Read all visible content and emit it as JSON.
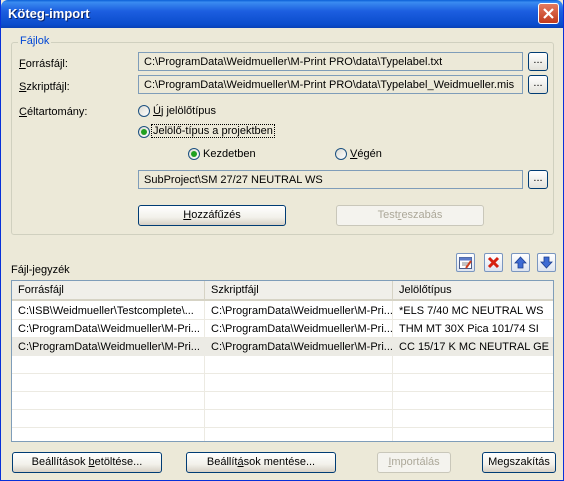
{
  "window": {
    "title": "Köteg-import"
  },
  "group": {
    "label": "Fájlok"
  },
  "files": {
    "source_label_pre": "",
    "source_label_ul": "F",
    "source_label_post": "orrásfájl:",
    "source_path": "C:\\ProgramData\\Weidmueller\\M-Print PRO\\data\\Typelabel.txt",
    "script_label_ul": "S",
    "script_label_post": "zkriptfájl:",
    "script_path": "C:\\ProgramData\\Weidmueller\\M-Print PRO\\data\\Typelabel_Weidmueller.mis",
    "browse_label": "..."
  },
  "target": {
    "label_ul": "C",
    "label_post": "éltartomány:",
    "opt_new_ul": "Ú",
    "opt_new_post": "j jelölőtípus",
    "opt_project": "Jelölő-típus a projektben",
    "pos_begin": "Kezdetben",
    "pos_end_ul": "V",
    "pos_end_post": "égén",
    "project_path": "SubProject\\SM 27/27 NEUTRAL WS",
    "selected": "project",
    "position": "begin"
  },
  "buttons": {
    "append_ul": "H",
    "append_post": "ozzáfűzés",
    "testsize_pre": "Test",
    "testsize_ul": "r",
    "testsize_post": "eszabás",
    "load_pre": "Beállítások ",
    "load_ul": "b",
    "load_post": "etöltése...",
    "save_pre": "Beállít",
    "save_ul": "á",
    "save_post": "sok mentése...",
    "import_pre": "",
    "import_ul": "I",
    "import_post": "mportálás",
    "cancel_label": "Megszakítás"
  },
  "filelist": {
    "label": "Fájl-jegyzék",
    "columns": [
      "Forrásfájl",
      "Szkriptfájl",
      "Jelölőtípus"
    ],
    "rows": [
      [
        "C:\\ISB\\Weidmueller\\Testcomplete\\...",
        "C:\\ProgramData\\Weidmueller\\M-Pri...",
        "*ELS 7/40 MC NEUTRAL WS"
      ],
      [
        "C:\\ProgramData\\Weidmueller\\M-Pri...",
        "C:\\ProgramData\\Weidmueller\\M-Pri...",
        "THM MT 30X Pica 101/74 SI"
      ],
      [
        "C:\\ProgramData\\Weidmueller\\M-Pri...",
        "C:\\ProgramData\\Weidmueller\\M-Pri...",
        "CC 15/17 K MC NEUTRAL GE"
      ]
    ],
    "selected_row": 2,
    "tools": [
      "edit-icon",
      "delete-icon",
      "move-up-icon",
      "move-down-icon"
    ]
  },
  "colors": {
    "titlebar": "#0a4ccc",
    "accent": "#0046d5",
    "radio_dot": "#21a121",
    "row_selected": "#ecebe5"
  }
}
